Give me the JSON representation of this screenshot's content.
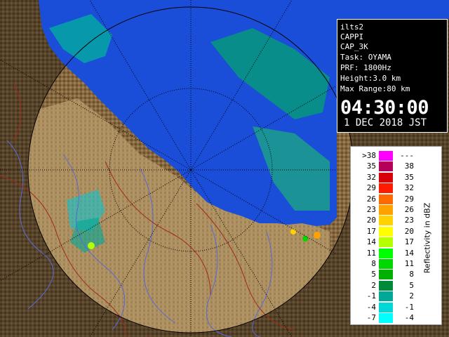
{
  "colors": {
    "sea": "#1b4ed8",
    "land_dark": "#3d2e1e",
    "land": "#86683f",
    "land_light": "#b79a69",
    "grid": "#000000",
    "rivers": "#5a6ad8",
    "borders": "#a02a1a"
  },
  "info": {
    "site": "ilts2",
    "product": "CAPPI",
    "product_id": "CAP_3K",
    "task": "Task: OYAMA",
    "prf": "PRF: 1800Hz",
    "height": "Height:3.0 km",
    "max_range": "Max Range:80 km",
    "time": "04:30:00",
    "date": "1 DEC 2018 JST"
  },
  "legend": {
    "title": "Reflectivity in dBZ",
    "rows": [
      {
        "lo": ">38",
        "hi": "---",
        "color": "#ff00ff"
      },
      {
        "lo": "35",
        "hi": "38",
        "color": "#b5005a"
      },
      {
        "lo": "32",
        "hi": "35",
        "color": "#d8000a"
      },
      {
        "lo": "29",
        "hi": "32",
        "color": "#ff1a00"
      },
      {
        "lo": "26",
        "hi": "29",
        "color": "#ff6a00"
      },
      {
        "lo": "23",
        "hi": "26",
        "color": "#ffa200"
      },
      {
        "lo": "20",
        "hi": "23",
        "color": "#ffd200"
      },
      {
        "lo": "17",
        "hi": "20",
        "color": "#ffff00"
      },
      {
        "lo": "14",
        "hi": "17",
        "color": "#b6ff00"
      },
      {
        "lo": "11",
        "hi": "14",
        "color": "#00ff00"
      },
      {
        "lo": "8",
        "hi": "11",
        "color": "#00d800"
      },
      {
        "lo": "5",
        "hi": "8",
        "color": "#00b000"
      },
      {
        "lo": "2",
        "hi": "5",
        "color": "#008a3a"
      },
      {
        "lo": "-1",
        "hi": "2",
        "color": "#00a898"
      },
      {
        "lo": "-4",
        "hi": "-1",
        "color": "#00d8d8"
      },
      {
        "lo": "-7",
        "hi": "-4",
        "color": "#00ffff"
      }
    ]
  }
}
